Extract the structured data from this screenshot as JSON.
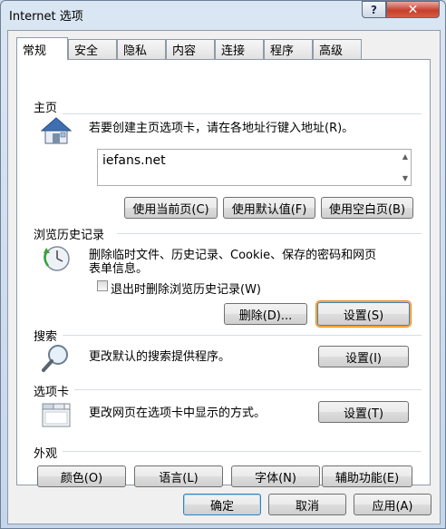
{
  "window": {
    "title": "Internet 选项",
    "help_glyph": "?",
    "close_glyph": "✕"
  },
  "tabs": [
    {
      "label": "常规",
      "active": true
    },
    {
      "label": "安全"
    },
    {
      "label": "隐私"
    },
    {
      "label": "内容"
    },
    {
      "label": "连接"
    },
    {
      "label": "程序"
    },
    {
      "label": "高级"
    }
  ],
  "home": {
    "header": "主页",
    "description": "若要创建主页选项卡，请在各地址行键入地址(R)。",
    "url": "iefans.net",
    "buttons": {
      "current": "使用当前页(C)",
      "default": "使用默认值(F)",
      "blank": "使用空白页(B)"
    }
  },
  "history": {
    "header": "浏览历史记录",
    "description_line1": "删除临时文件、历史记录、Cookie、保存的密码和网页",
    "description_line2": "表单信息。",
    "checkbox_label": "退出时删除浏览历史记录(W)",
    "checkbox_checked": false,
    "delete_button": "删除(D)...",
    "settings_button": "设置(S)"
  },
  "search": {
    "header": "搜索",
    "description": "更改默认的搜索提供程序。",
    "settings_button": "设置(I)"
  },
  "tabs_section": {
    "header": "选项卡",
    "description": "更改网页在选项卡中显示的方式。",
    "settings_button": "设置(T)"
  },
  "appearance": {
    "header": "外观",
    "buttons": {
      "colors": "颜色(O)",
      "languages": "语言(L)",
      "fonts": "字体(N)",
      "accessibility": "辅助功能(E)"
    }
  },
  "footer": {
    "ok": "确定",
    "cancel": "取消",
    "apply": "应用(A)"
  },
  "colors": {
    "focus_ring": "#f08a24",
    "title_bar": "#c5d6ea",
    "close_red": "#c7402c"
  }
}
